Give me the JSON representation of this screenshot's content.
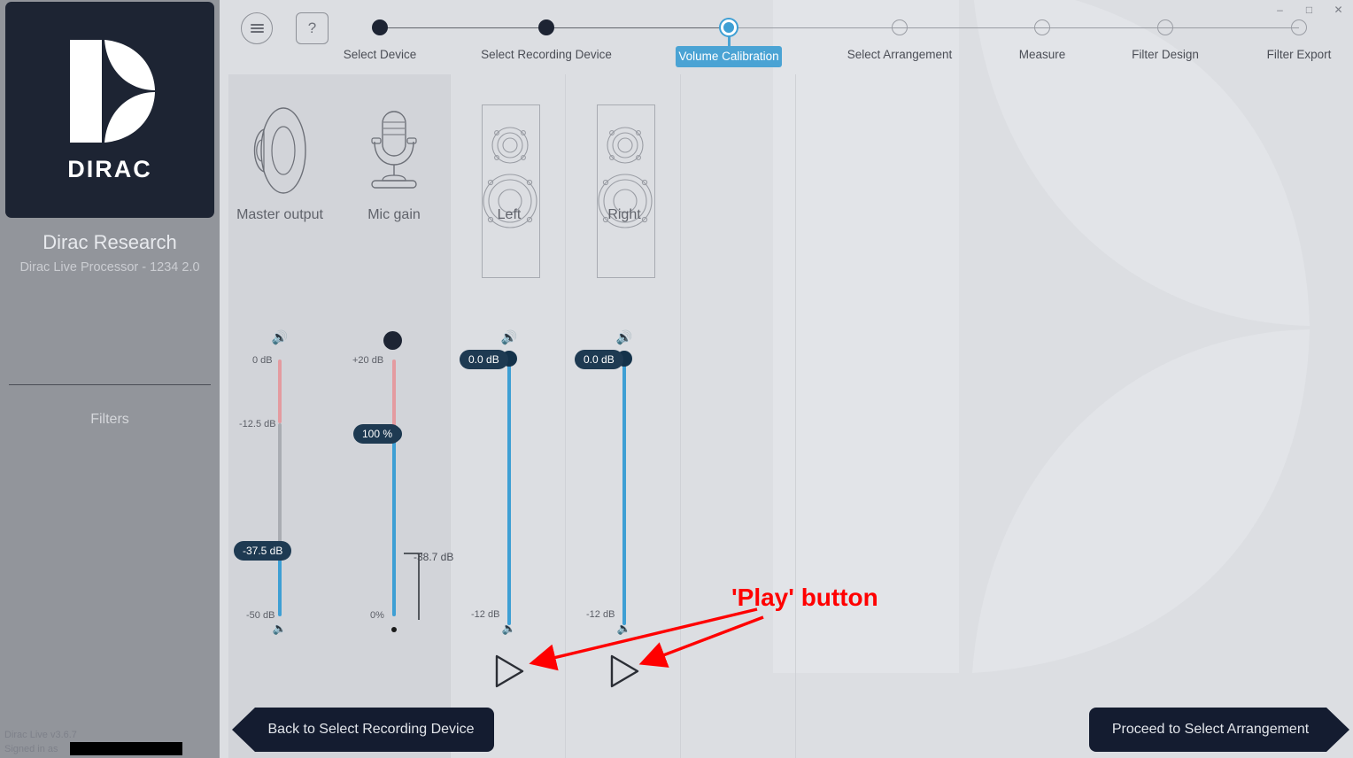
{
  "window": {
    "minimize": "–",
    "maximize": "□",
    "close": "✕"
  },
  "sidebar": {
    "logo_word": "DIRAC",
    "title": "Dirac Research",
    "subtitle": "Dirac Live Processor - 1234 2.0",
    "filters_label": "Filters",
    "version": "Dirac Live v3.6.7",
    "signed_in": "Signed in as",
    "logo_icon": "dirac-d-logo"
  },
  "header": {
    "menu_icon": "hamburger-menu-icon",
    "help_label": "?"
  },
  "stepper": {
    "steps": [
      {
        "label": "Select Device",
        "state": "done"
      },
      {
        "label": "Select Recording Device",
        "state": "done"
      },
      {
        "label": "Volume Calibration",
        "state": "current"
      },
      {
        "label": "Select Arrangement",
        "state": "todo"
      },
      {
        "label": "Measure",
        "state": "todo"
      },
      {
        "label": "Filter Design",
        "state": "todo"
      },
      {
        "label": "Filter Export",
        "state": "todo"
      }
    ],
    "active_color": "#4aa3d4"
  },
  "controls": {
    "master": {
      "icon": "speaker-cone-icon",
      "name": "Master output",
      "volume_up_icon": "volume-high-icon",
      "volume_down_icon": "volume-low-icon",
      "top_tick": "0 dB",
      "mid_tick": "-12.5 dB",
      "bottom_tick": "-50 dB",
      "value_label": "-37.5 dB"
    },
    "mic": {
      "icon": "microphone-icon",
      "name": "Mic gain",
      "top_tick": "+20 dB",
      "bottom_tick": "0%",
      "value_label": "100 %",
      "level_label": "-38.7 dB"
    }
  },
  "channels": [
    {
      "name": "Left",
      "speaker_icon": "floorstanding-speaker-icon",
      "volume_up_icon": "volume-high-icon",
      "volume_down_icon": "volume-low-icon",
      "value_label": "0.0 dB",
      "bottom_tick": "-12 dB",
      "play_icon": "play-triangle-icon"
    },
    {
      "name": "Right",
      "speaker_icon": "floorstanding-speaker-icon",
      "volume_up_icon": "volume-high-icon",
      "volume_down_icon": "volume-low-icon",
      "value_label": "0.0 dB",
      "bottom_tick": "-12 dB",
      "play_icon": "play-triangle-icon"
    }
  ],
  "nav": {
    "back_label": "Back to Select Recording Device",
    "forward_label": "Proceed to Select Arrangement"
  },
  "annotation": {
    "text": "'Play' button",
    "color": "#ff0000"
  }
}
